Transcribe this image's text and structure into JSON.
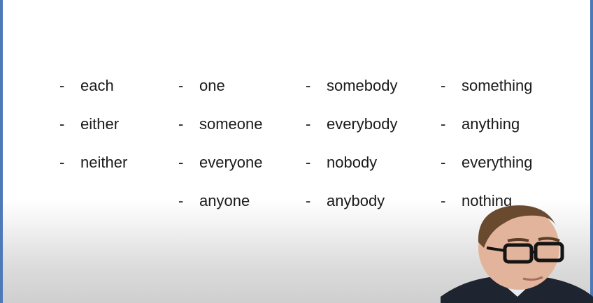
{
  "slide": {
    "bullet": "-",
    "columns": [
      {
        "words": [
          "each",
          "either",
          "neither"
        ]
      },
      {
        "words": [
          "one",
          "someone",
          "everyone",
          "anyone"
        ]
      },
      {
        "words": [
          "somebody",
          "everybody",
          "nobody",
          "anybody"
        ]
      },
      {
        "words": [
          "something",
          "anything",
          "everything",
          "nothing"
        ]
      }
    ]
  },
  "colors": {
    "edge": "#4d79b8",
    "text": "#1a1a1a"
  }
}
